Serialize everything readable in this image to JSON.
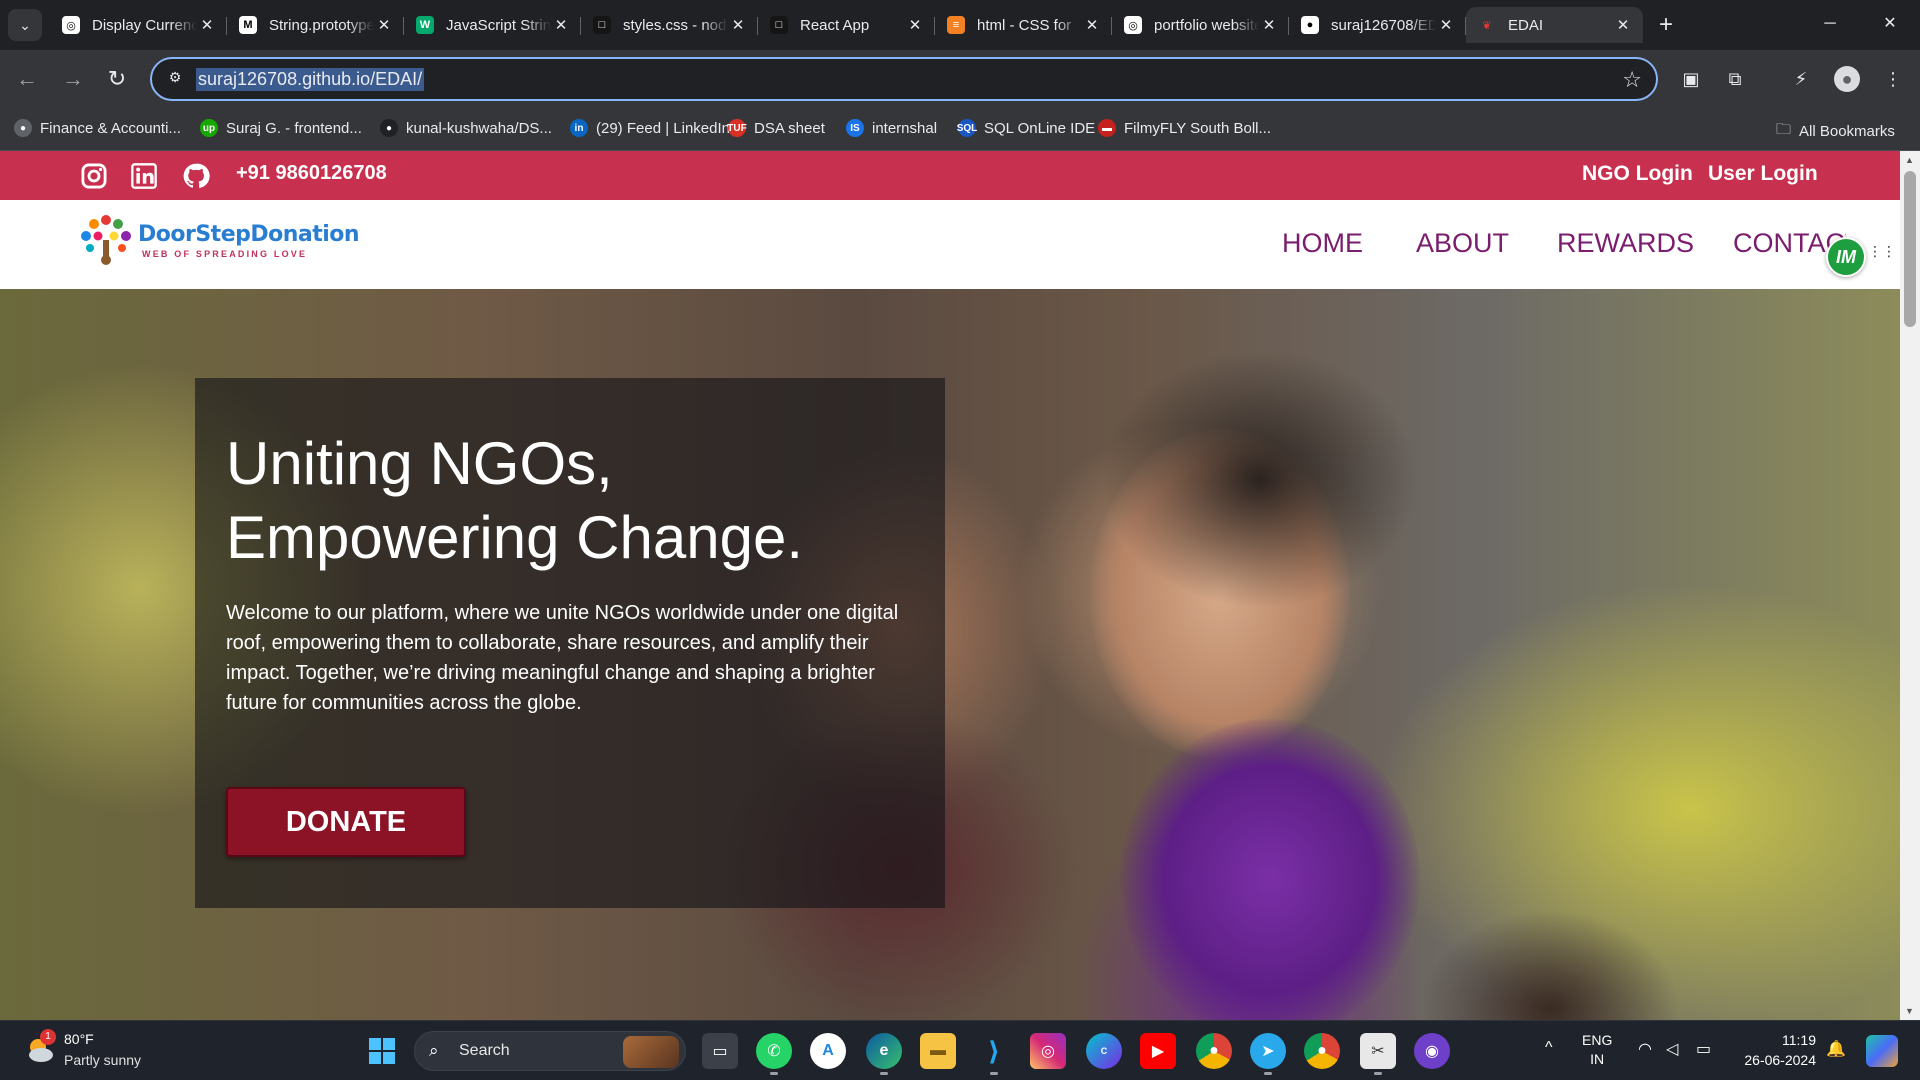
{
  "browser": {
    "tabs": [
      {
        "title": "Display Currency",
        "icon": "openai-icon",
        "active": false
      },
      {
        "title": "String.prototype",
        "icon": "medium-icon",
        "active": false
      },
      {
        "title": "JavaScript String",
        "icon": "w3schools-icon",
        "active": false
      },
      {
        "title": "styles.css - node",
        "icon": "codesandbox-icon",
        "active": false
      },
      {
        "title": "React App",
        "icon": "codesandbox-icon",
        "active": false
      },
      {
        "title": "html - CSS for",
        "icon": "stackoverflow-icon",
        "active": false
      },
      {
        "title": "portfolio website",
        "icon": "chatgpt-icon",
        "active": false
      },
      {
        "title": "suraj126708/EDAI",
        "icon": "github-icon",
        "active": false
      },
      {
        "title": "EDAI",
        "icon": "heart-tree-icon",
        "active": true
      }
    ],
    "url": "suraj126708.github.io/EDAI/",
    "bookmarks": [
      {
        "label": "Finance & Accounti...",
        "color": "#5f6368",
        "glyph": "●"
      },
      {
        "label": "Suraj G. - frontend...",
        "color": "#14a800",
        "glyph": "up"
      },
      {
        "label": "kunal-kushwaha/DS...",
        "color": "#202124",
        "glyph": "●"
      },
      {
        "label": "(29) Feed | LinkedIn",
        "color": "#0a66c2",
        "glyph": "in"
      },
      {
        "label": "DSA sheet",
        "color": "#d93025",
        "glyph": "TUF"
      },
      {
        "label": "internshal",
        "color": "#1a73e8",
        "glyph": "IS"
      },
      {
        "label": "SQL OnLine IDE",
        "color": "#1a56c2",
        "glyph": "SQL"
      },
      {
        "label": "FilmyFLY South Boll...",
        "color": "#c5221f",
        "glyph": "▬"
      }
    ],
    "all_bookmarks": "All Bookmarks"
  },
  "site": {
    "phone": "+91 9860126708",
    "ngo_login": "NGO Login",
    "user_login": "User Login",
    "brand": "DoorStepDonation",
    "tagline": "WEB OF SPREADING LOVE",
    "nav": [
      "HOME",
      "ABOUT",
      "REWARDS",
      "CONTACT"
    ],
    "hero": {
      "headline_line1": "Uniting NGOs,",
      "headline_line2": "Empowering Change.",
      "intro": "Welcome to our platform, where we unite NGOs worldwide under one digital roof, empowering them to collaborate, share resources, and amplify their impact. Together, we’re driving meaningful change and shaping a brighter future for communities across the globe.",
      "cta": "DONATE"
    },
    "extension_badge": "IM",
    "colors": {
      "topbar": "#c8304f",
      "nav_text": "#7a1d6e",
      "cta": "#8c1226",
      "brand_blue": "#2a7ed1"
    }
  },
  "taskbar": {
    "weather_temp": "80°F",
    "weather_desc": "Partly sunny",
    "weather_alert_count": "1",
    "search_label": "Search",
    "apps": [
      "task-view",
      "whatsapp",
      "app-store",
      "edge",
      "file-explorer",
      "vscode",
      "instagram",
      "canva",
      "youtube",
      "chrome",
      "telegram",
      "chrome-active",
      "snipping-tool",
      "github"
    ],
    "lang_line1": "ENG",
    "lang_line2": "IN",
    "time": "11:19",
    "date": "26-06-2024"
  }
}
